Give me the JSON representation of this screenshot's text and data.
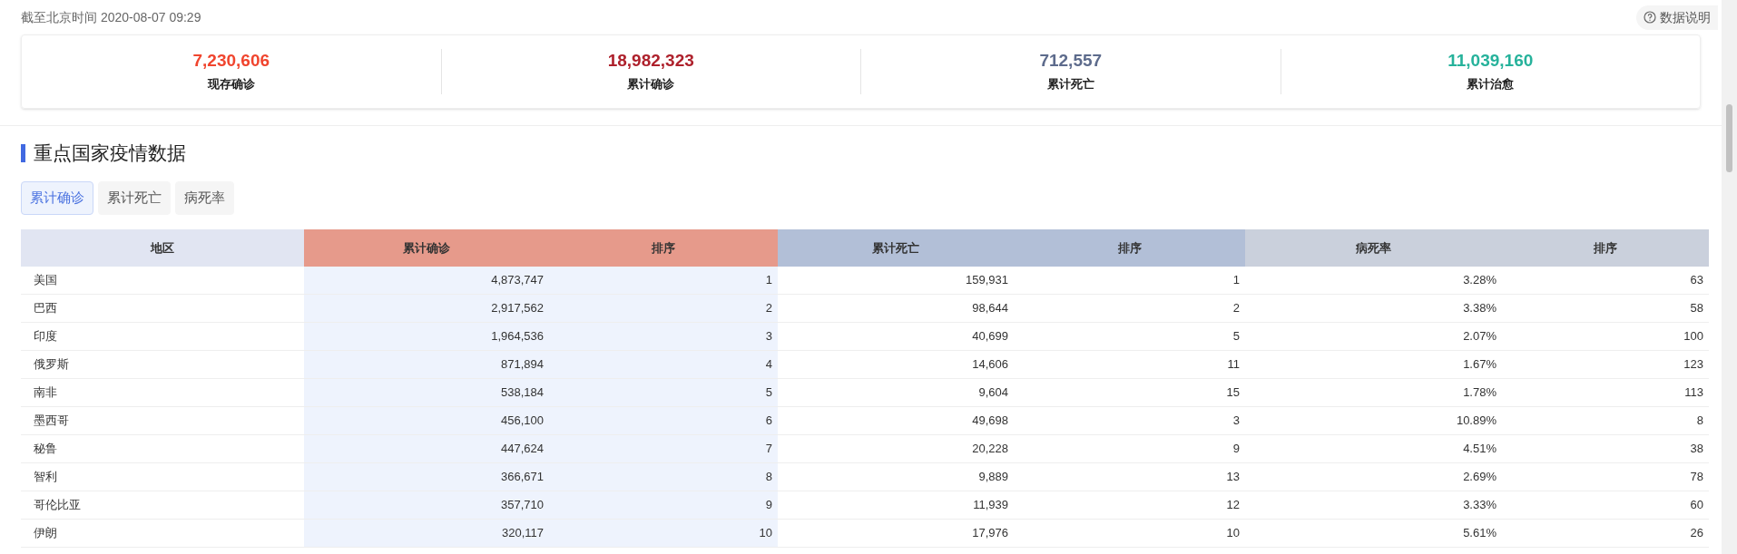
{
  "updated": "截至北京时间 2020-08-07 09:29",
  "help_button": "数据说明",
  "stats": [
    {
      "value": "7,230,606",
      "label": "现存确诊",
      "color": "#f0452e"
    },
    {
      "value": "18,982,323",
      "label": "累计确诊",
      "color": "#ae212c"
    },
    {
      "value": "712,557",
      "label": "累计死亡",
      "color": "#5d6b8c"
    },
    {
      "value": "11,039,160",
      "label": "累计治愈",
      "color": "#26b29b"
    }
  ],
  "section_title": "重点国家疫情数据",
  "tabs": [
    {
      "label": "累计确诊",
      "selected": true
    },
    {
      "label": "累计死亡",
      "selected": false
    },
    {
      "label": "病死率",
      "selected": false
    }
  ],
  "table": {
    "header_groups": [
      {
        "labels": [
          "地区"
        ],
        "color": "#e1e5f2"
      },
      {
        "labels": [
          "累计确诊",
          "排序"
        ],
        "color": "#e69a8b"
      },
      {
        "labels": [
          "累计死亡",
          "排序"
        ],
        "color": "#b2bfd7"
      },
      {
        "labels": [
          "病死率",
          "排序"
        ],
        "color": "#cad0dc"
      }
    ],
    "rows": [
      [
        "美国",
        "4,873,747",
        "1",
        "159,931",
        "1",
        "3.28%",
        "63"
      ],
      [
        "巴西",
        "2,917,562",
        "2",
        "98,644",
        "2",
        "3.38%",
        "58"
      ],
      [
        "印度",
        "1,964,536",
        "3",
        "40,699",
        "5",
        "2.07%",
        "100"
      ],
      [
        "俄罗斯",
        "871,894",
        "4",
        "14,606",
        "11",
        "1.67%",
        "123"
      ],
      [
        "南非",
        "538,184",
        "5",
        "9,604",
        "15",
        "1.78%",
        "113"
      ],
      [
        "墨西哥",
        "456,100",
        "6",
        "49,698",
        "3",
        "10.89%",
        "8"
      ],
      [
        "秘鲁",
        "447,624",
        "7",
        "20,228",
        "9",
        "4.51%",
        "38"
      ],
      [
        "智利",
        "366,671",
        "8",
        "9,889",
        "13",
        "2.69%",
        "78"
      ],
      [
        "哥伦比亚",
        "357,710",
        "9",
        "11,939",
        "12",
        "3.33%",
        "60"
      ],
      [
        "伊朗",
        "320,117",
        "10",
        "17,976",
        "10",
        "5.61%",
        "26"
      ]
    ]
  }
}
